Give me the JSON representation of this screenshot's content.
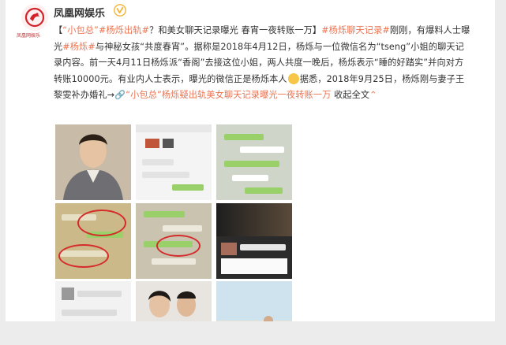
{
  "account": {
    "name": "凤凰网娱乐",
    "logo_caption": "凤凰网娱乐",
    "verified": true
  },
  "post": {
    "parts": [
      {
        "t": "【",
        "c": ""
      },
      {
        "t": "“小包总”",
        "c": "link"
      },
      {
        "t": "#杨烁出轨#",
        "c": "topic"
      },
      {
        "t": "？和美女聊天记录曝光 春宵一夜转账一万】",
        "c": ""
      },
      {
        "t": "#杨烁聊天记录#",
        "c": "topic"
      },
      {
        "t": "刚刚，有爆料人士曝光",
        "c": ""
      },
      {
        "t": "#杨烁#",
        "c": "topic"
      },
      {
        "t": "与神秘女孩“共度春宵”。据称是2018年4月12日，杨烁与一位微信名为“tseng”小姐的聊天记录内容。前一天4月11日杨烁派“香阁”去接这位小姐，两人共度一晚后，杨烁表示“睡的好踏实”并向对方转账10000元。有业内人士表示，曝光的微信正是杨烁本人",
        "c": ""
      },
      {
        "t": "",
        "c": "emoji"
      },
      {
        "t": "据悉，2018年9月25日，杨烁刚与妻子王黎雯补办婚礼→",
        "c": ""
      },
      {
        "t": "🔗“小包总”杨烁疑出轨美女聊天记录曝光一夜转账一万",
        "c": "link"
      },
      {
        "t": " 收起全文",
        "c": ""
      },
      {
        "t": "⌃",
        "c": "link"
      }
    ]
  },
  "images": [
    {
      "name": "photo-yang-shuo-portrait"
    },
    {
      "name": "chat-screenshot-1"
    },
    {
      "name": "chat-screenshot-2"
    },
    {
      "name": "chat-screenshot-circled-1"
    },
    {
      "name": "chat-screenshot-circled-2"
    },
    {
      "name": "chat-screenshot-dark"
    },
    {
      "name": "chat-screenshot-3"
    },
    {
      "name": "photo-couple-wedding"
    },
    {
      "name": "photo-beach-wedding"
    }
  ],
  "colors": {
    "link": "#eb7350",
    "background": "#ececec",
    "card": "#ffffff"
  }
}
